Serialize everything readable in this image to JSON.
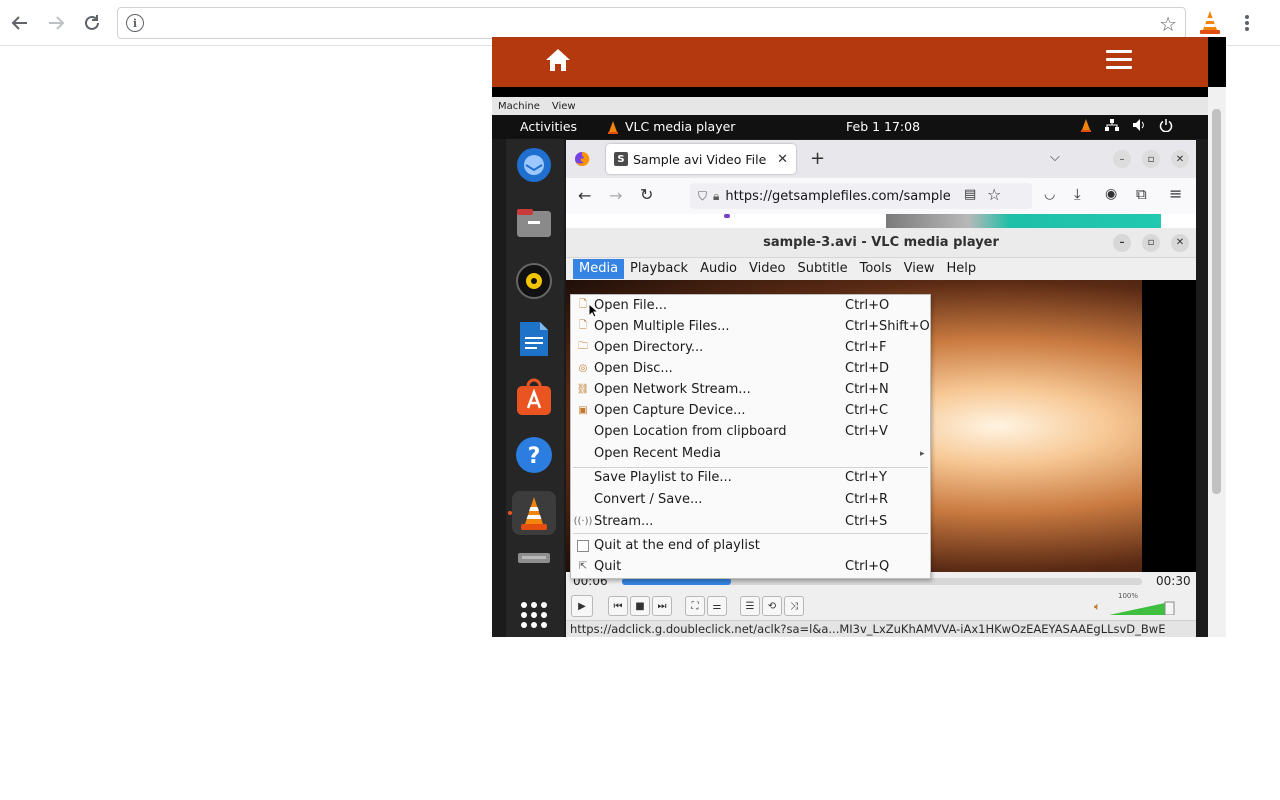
{
  "chrome": {
    "url_text": "",
    "nav_icons": [
      "back-arrow-icon",
      "forward-arrow-icon",
      "reload-icon"
    ],
    "extension_icon": "vlc-cone-icon"
  },
  "viewer": {
    "accent_color": "#b5390e",
    "menubar": [
      "Machine",
      "View"
    ]
  },
  "gnome": {
    "activities": "Activities",
    "app_name": "VLC media player",
    "clock": "Feb 1  17:08",
    "dock": [
      "thunderbird-icon",
      "files-icon",
      "rhythmbox-icon",
      "writer-icon",
      "app-center-icon",
      "help-icon",
      "vlc-icon",
      "drive-icon",
      "app-grid-icon"
    ]
  },
  "firefox": {
    "tab_title": "Sample avi Video File Do",
    "url": "https://getsamplefiles.com/sample"
  },
  "vlc": {
    "title": "sample-3.avi - VLC media player",
    "menus": [
      "Media",
      "Playback",
      "Audio",
      "Video",
      "Subtitle",
      "Tools",
      "View",
      "Help"
    ],
    "elapsed": "00:06",
    "total": "00:30",
    "progress": 0.21,
    "volume_label": "100%",
    "status_url": "https://adclick.g.doubleclick.net/aclk?sa=l&a...MI3v_LxZuKhAMVVA-iAx1HKwOzEAEYASAAEgLLsvD_BwE"
  },
  "media_menu": {
    "items": [
      {
        "label": "Open File...",
        "shortcut": "Ctrl+O",
        "icon": "file-icon"
      },
      {
        "label": "Open Multiple Files...",
        "shortcut": "Ctrl+Shift+O",
        "icon": "files-icon"
      },
      {
        "label": "Open Directory...",
        "shortcut": "Ctrl+F",
        "icon": "folder-icon"
      },
      {
        "label": "Open Disc...",
        "shortcut": "Ctrl+D",
        "icon": "disc-icon"
      },
      {
        "label": "Open Network Stream...",
        "shortcut": "Ctrl+N",
        "icon": "network-icon"
      },
      {
        "label": "Open Capture Device...",
        "shortcut": "Ctrl+C",
        "icon": "capture-icon"
      },
      {
        "label": "Open Location from clipboard",
        "shortcut": "Ctrl+V",
        "icon": ""
      },
      {
        "label": "Open Recent Media",
        "shortcut": "",
        "icon": ""
      },
      {
        "label": "Save Playlist to File...",
        "shortcut": "Ctrl+Y",
        "icon": ""
      },
      {
        "label": "Convert / Save...",
        "shortcut": "Ctrl+R",
        "icon": ""
      },
      {
        "label": "Stream...",
        "shortcut": "Ctrl+S",
        "icon": "stream-icon"
      },
      {
        "label": "Quit at the end of playlist",
        "shortcut": "",
        "icon": "checkbox"
      },
      {
        "label": "Quit",
        "shortcut": "Ctrl+Q",
        "icon": "quit-icon"
      }
    ]
  }
}
